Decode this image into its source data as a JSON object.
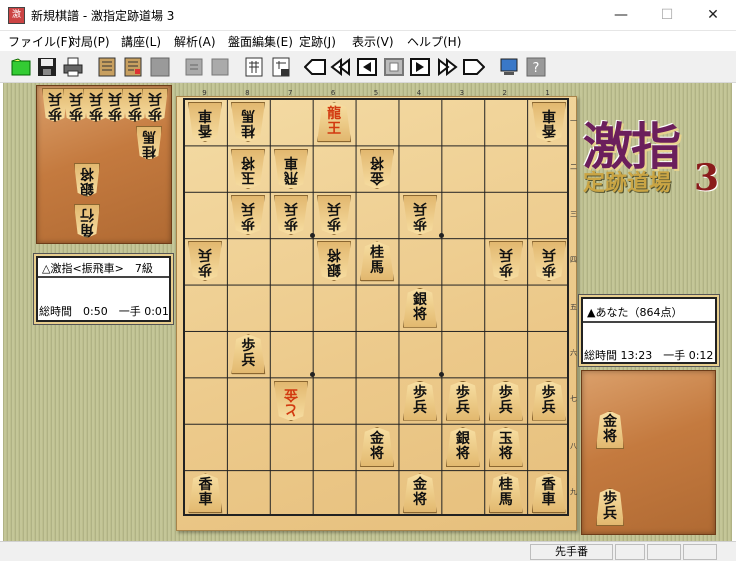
{
  "window": {
    "title": "新規棋譜 - 激指定跡道場 3",
    "icon_text": "激",
    "minimize": "—",
    "maximize": "☐",
    "close": "✕"
  },
  "menu": [
    {
      "label": "ファイル(F)"
    },
    {
      "label": "対局(P)"
    },
    {
      "label": "講座(L)"
    },
    {
      "label": "解析(A)"
    },
    {
      "label": "盤面編集(E)"
    },
    {
      "label": "定跡(J)"
    },
    {
      "label": "表示(V)"
    },
    {
      "label": "ヘルプ(H)"
    }
  ],
  "toolbar": [
    {
      "name": "new-icon"
    },
    {
      "name": "save-icon"
    },
    {
      "name": "print-icon"
    },
    {
      "name": "kifu-icon"
    },
    {
      "name": "kifu-edit-icon"
    },
    {
      "name": "gray-square-icon"
    },
    {
      "name": "undo-icon"
    },
    {
      "name": "redo-icon"
    },
    {
      "name": "board-input-icon"
    },
    {
      "name": "board-save-icon"
    },
    {
      "name": "first-move-icon"
    },
    {
      "name": "back-many-icon"
    },
    {
      "name": "back-one-icon"
    },
    {
      "name": "stop-icon"
    },
    {
      "name": "forward-one-icon"
    },
    {
      "name": "forward-many-icon"
    },
    {
      "name": "last-move-icon"
    },
    {
      "name": "screen-icon"
    },
    {
      "name": "help-icon"
    }
  ],
  "board": {
    "file_labels": [
      "9",
      "8",
      "7",
      "6",
      "5",
      "4",
      "3",
      "2",
      "1"
    ],
    "rank_labels": [
      "一",
      "二",
      "三",
      "四",
      "五",
      "六",
      "七",
      "八",
      "九"
    ],
    "pieces": [
      {
        "f": 9,
        "r": 1,
        "c": "香車",
        "o": "g"
      },
      {
        "f": 8,
        "r": 1,
        "c": "桂馬",
        "o": "g"
      },
      {
        "f": 6,
        "r": 1,
        "c": "龍王",
        "o": "s",
        "red": true
      },
      {
        "f": 1,
        "r": 1,
        "c": "香車",
        "o": "g"
      },
      {
        "f": 8,
        "r": 2,
        "c": "玉将",
        "o": "g"
      },
      {
        "f": 7,
        "r": 2,
        "c": "飛車",
        "o": "g"
      },
      {
        "f": 5,
        "r": 2,
        "c": "金将",
        "o": "g"
      },
      {
        "f": 8,
        "r": 3,
        "c": "歩兵",
        "o": "g"
      },
      {
        "f": 7,
        "r": 3,
        "c": "歩兵",
        "o": "g"
      },
      {
        "f": 6,
        "r": 3,
        "c": "歩兵",
        "o": "g"
      },
      {
        "f": 4,
        "r": 3,
        "c": "歩兵",
        "o": "g"
      },
      {
        "f": 9,
        "r": 4,
        "c": "歩兵",
        "o": "g"
      },
      {
        "f": 6,
        "r": 4,
        "c": "銀将",
        "o": "g"
      },
      {
        "f": 5,
        "r": 4,
        "c": "桂馬",
        "o": "s"
      },
      {
        "f": 2,
        "r": 4,
        "c": "歩兵",
        "o": "g"
      },
      {
        "f": 1,
        "r": 4,
        "c": "歩兵",
        "o": "g"
      },
      {
        "f": 4,
        "r": 5,
        "c": "銀将",
        "o": "s"
      },
      {
        "f": 8,
        "r": 6,
        "c": "歩兵",
        "o": "s"
      },
      {
        "f": 7,
        "r": 7,
        "c": "と金",
        "o": "g",
        "red": true
      },
      {
        "f": 4,
        "r": 7,
        "c": "歩兵",
        "o": "s"
      },
      {
        "f": 3,
        "r": 7,
        "c": "歩兵",
        "o": "s"
      },
      {
        "f": 2,
        "r": 7,
        "c": "歩兵",
        "o": "s"
      },
      {
        "f": 1,
        "r": 7,
        "c": "歩兵",
        "o": "s"
      },
      {
        "f": 5,
        "r": 8,
        "c": "金将",
        "o": "s"
      },
      {
        "f": 3,
        "r": 8,
        "c": "銀将",
        "o": "s"
      },
      {
        "f": 2,
        "r": 8,
        "c": "玉将",
        "o": "s"
      },
      {
        "f": 9,
        "r": 9,
        "c": "香車",
        "o": "s"
      },
      {
        "f": 4,
        "r": 9,
        "c": "金将",
        "o": "s"
      },
      {
        "f": 2,
        "r": 9,
        "c": "桂馬",
        "o": "s"
      },
      {
        "f": 1,
        "r": 9,
        "c": "香車",
        "o": "s"
      }
    ]
  },
  "gote": {
    "name": "△激指<振飛車>　7級",
    "time": "総時間　0:50　一手 0:01",
    "hand": [
      {
        "c": "歩兵"
      },
      {
        "c": "歩兵"
      },
      {
        "c": "歩兵"
      },
      {
        "c": "歩兵"
      },
      {
        "c": "歩兵"
      },
      {
        "c": "歩兵"
      },
      {
        "c": "桂馬"
      },
      {
        "c": "銀将"
      },
      {
        "c": "角行"
      }
    ]
  },
  "sente": {
    "name": "▲あなた（864点）",
    "time": "総時間 13:23　一手 0:12",
    "hand": [
      {
        "c": "金将"
      },
      {
        "c": "歩兵"
      }
    ]
  },
  "logo": {
    "big": "激指",
    "small": "定跡道場",
    "num": "3"
  },
  "status": {
    "turn": "先手番"
  }
}
